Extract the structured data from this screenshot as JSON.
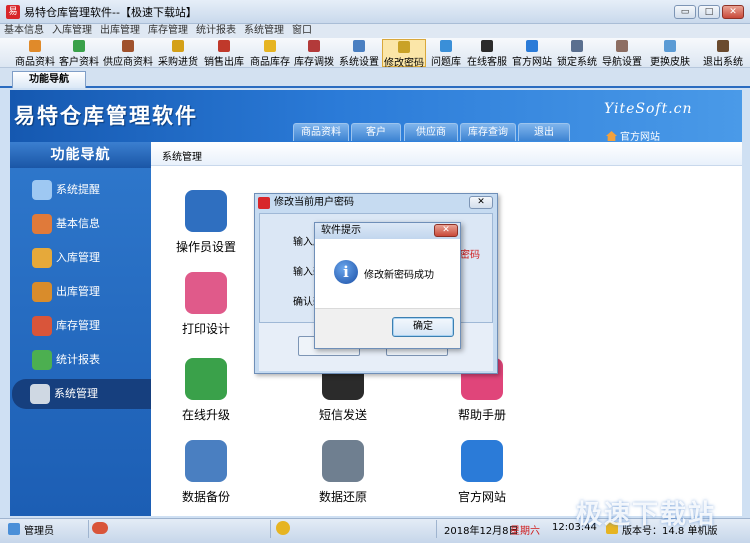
{
  "window": {
    "title": "易特仓库管理软件--【极速下载站】",
    "min": "▭",
    "max": "□",
    "close": "✕"
  },
  "menubar": [
    "基本信息",
    "入库管理",
    "出库管理",
    "库存管理",
    "统计报表",
    "系统管理",
    "窗口"
  ],
  "toolbar": [
    {
      "label": "商品资料",
      "color": "#e08a2a"
    },
    {
      "label": "客户资料",
      "color": "#3aa14a"
    },
    {
      "label": "供应商资料",
      "color": "#a0522d"
    },
    {
      "label": "采购进货",
      "color": "#d4a017"
    },
    {
      "label": "销售出库",
      "color": "#c0392b"
    },
    {
      "label": "商品库存",
      "color": "#e6b422"
    },
    {
      "label": "库存调拨",
      "color": "#b33a3a"
    },
    {
      "label": "系统设置",
      "color": "#4a7fc1"
    },
    {
      "label": "修改密码",
      "color": "#c9a227"
    },
    {
      "label": "问题库",
      "color": "#3a8fd8"
    },
    {
      "label": "在线客服",
      "color": "#2b2b2b"
    },
    {
      "label": "官方网站",
      "color": "#2b7bd8"
    },
    {
      "label": "锁定系统",
      "color": "#5a6f8f"
    },
    {
      "label": "导航设置",
      "color": "#8d6e63"
    },
    {
      "label": "更换皮肤",
      "color": "#5b9bd5"
    },
    {
      "label": "退出系统",
      "color": "#6b4b2f"
    }
  ],
  "tab": {
    "label": "功能导航"
  },
  "banner": {
    "title": "易特仓库管理软件",
    "brand": "YiteSoft.cn",
    "nav": [
      "商品资料",
      "客户",
      "供应商",
      "库存查询",
      "退出"
    ],
    "home_link": "官方网站"
  },
  "sidebar": {
    "header": "功能导航",
    "items": [
      {
        "label": "系统提醒",
        "color": "#9ec8f2"
      },
      {
        "label": "基本信息",
        "color": "#e07a3a"
      },
      {
        "label": "入库管理",
        "color": "#e6a93a"
      },
      {
        "label": "出库管理",
        "color": "#d98c2b"
      },
      {
        "label": "库存管理",
        "color": "#d9553a"
      },
      {
        "label": "统计报表",
        "color": "#4caf50"
      },
      {
        "label": "系统管理",
        "color": "#cfd8e3"
      }
    ]
  },
  "main": {
    "breadcrumb": "系统管理",
    "cells": [
      {
        "label": "操作员设置",
        "color": "#2f6fc0"
      },
      {
        "label": "打印设计",
        "color": "#e05a8a"
      },
      {
        "label": "在线升级",
        "color": "#3aa14a"
      },
      {
        "label": "短信发送",
        "color": "#2b2b2b"
      },
      {
        "label": "帮助手册",
        "color": "#e0457a"
      },
      {
        "label": "数据备份",
        "color": "#4a7fc1"
      },
      {
        "label": "数据还原",
        "color": "#6f7f90"
      },
      {
        "label": "官方网站",
        "color": "#2b7bd8"
      },
      {
        "label": "理",
        "color": "#4a7fc1"
      },
      {
        "label": "志",
        "color": "#c9a227"
      }
    ]
  },
  "password_dialog": {
    "title": "修改当前用户密码",
    "close": "✕",
    "labels": [
      "输入原",
      "输入新",
      "确认新"
    ],
    "hint": "密码"
  },
  "message_dialog": {
    "title": "软件提示",
    "close": "✕",
    "icon": "i",
    "message": "修改新密码成功",
    "ok": "确定"
  },
  "statusbar": {
    "user": "管理员",
    "date": "2018年12月8日",
    "weekday": "星期六",
    "time": "12:03:44",
    "version": "版本号：14.8 单机版"
  },
  "watermark": {
    "text": "极速下载站"
  }
}
